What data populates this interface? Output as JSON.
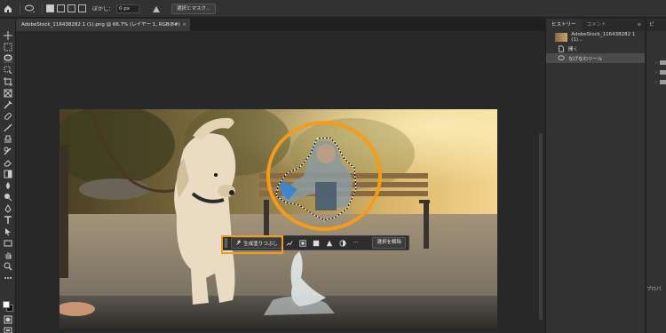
{
  "options_bar": {
    "feather_label": "ぼかし：",
    "feather_value": "0 px",
    "select_mask_button": "選択とマスク..."
  },
  "document": {
    "tab_title": "AdobeStock_116438282 1 (1).png @ 66.7% (レイヤー 1, RGB/8#)",
    "close_glyph": "×"
  },
  "contextual_taskbar": {
    "generative_fill_label": "生成塗りつぶし",
    "deselect_label": "選択を解除",
    "more_glyph": "···"
  },
  "history_panel": {
    "tabs": [
      "ヒストリー",
      "コメント"
    ],
    "menu_glyph": "≡",
    "snapshot_name": "AdobeStock_116438282 1 (1)...",
    "steps": [
      "開く",
      "なげなわツール"
    ]
  },
  "right_panel": {
    "top_tab": "ピ",
    "bottom_label": "プロパ"
  },
  "colors": {
    "highlight": "#f39c1a",
    "panel_bg": "#323232",
    "workspace_bg": "#282828"
  }
}
